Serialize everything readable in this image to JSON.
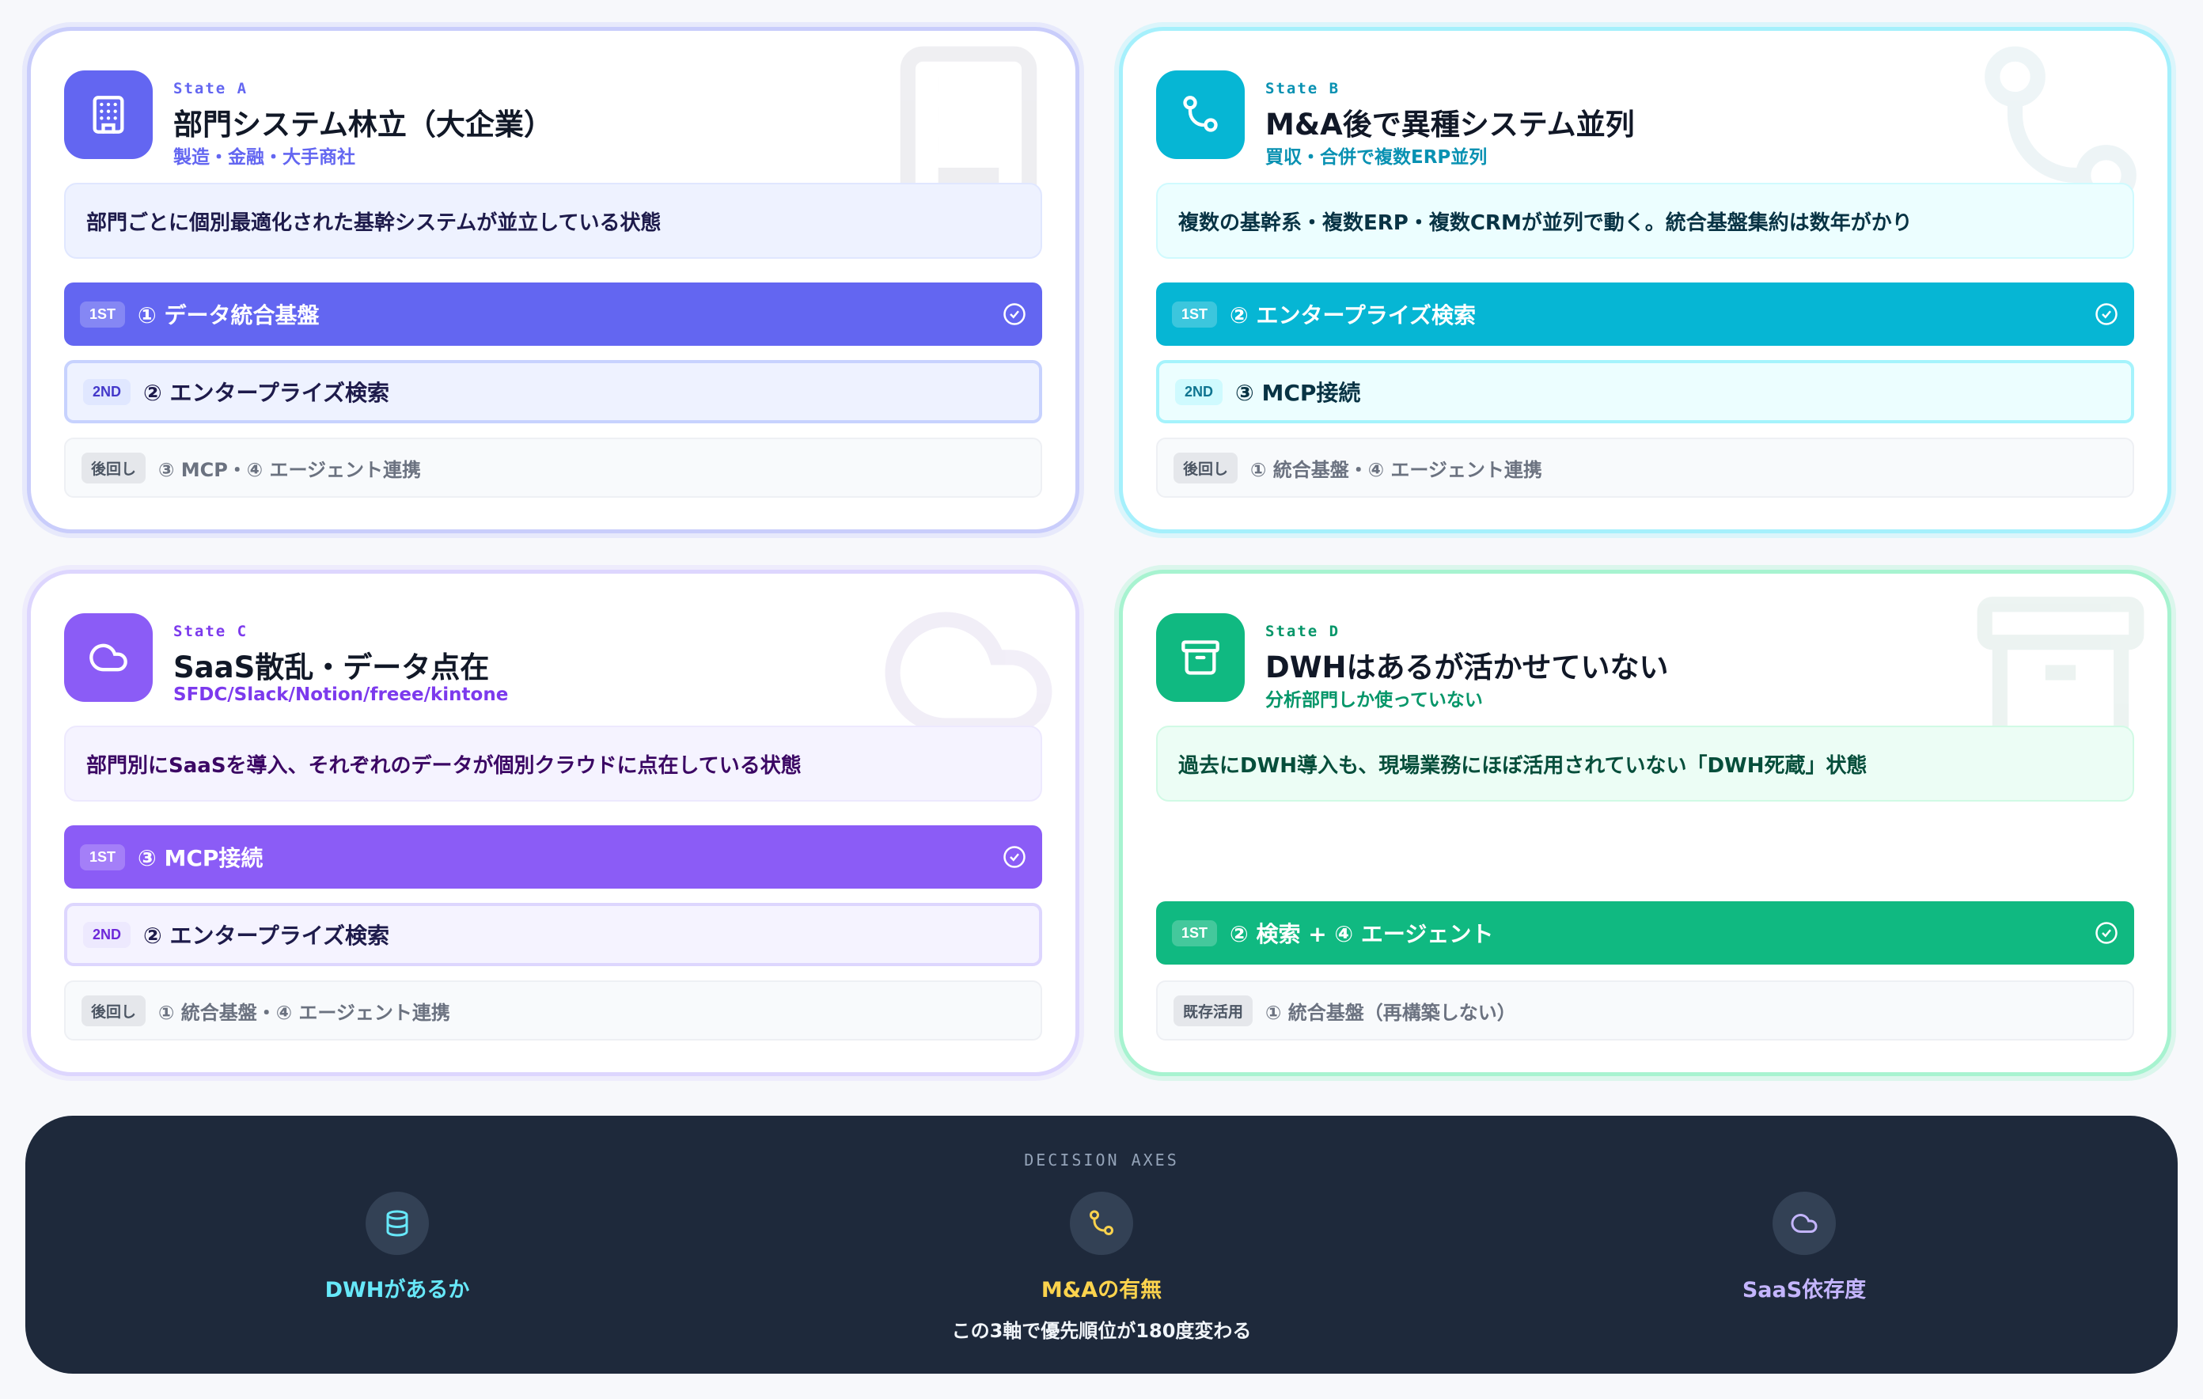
{
  "colors": {
    "state_a": "#6366f1",
    "state_b": "#06b6d4",
    "state_c": "#8b5cf6",
    "state_d": "#10b981",
    "axes_bg": "#1e293b"
  },
  "cards": [
    {
      "id": "a",
      "icon": "building-icon",
      "state_label": "State A",
      "title": "部門システム林立（大企業）",
      "subtitle": "製造・金融・大手商社",
      "description": "部門ごとに個別最適化された基幹システムが並立している状態",
      "first": {
        "badge": "1ST",
        "label": "① データ統合基盤"
      },
      "second": {
        "badge": "2ND",
        "label": "② エンタープライズ検索"
      },
      "later": {
        "badge": "後回し",
        "label": "③ MCP・④ エージェント連携"
      }
    },
    {
      "id": "b",
      "icon": "git-merge-icon",
      "state_label": "State B",
      "title": "M&A後で異種システム並列",
      "subtitle": "買収・合併で複数ERP並列",
      "description": "複数の基幹系・複数ERP・複数CRMが並列で動く。統合基盤集約は数年がかり",
      "first": {
        "badge": "1ST",
        "label": "② エンタープライズ検索"
      },
      "second": {
        "badge": "2ND",
        "label": "③ MCP接続"
      },
      "later": {
        "badge": "後回し",
        "label": "① 統合基盤・④ エージェント連携"
      }
    },
    {
      "id": "c",
      "icon": "cloud-icon",
      "state_label": "State C",
      "title": "SaaS散乱・データ点在",
      "subtitle": "SFDC/Slack/Notion/freee/kintone",
      "description": "部門別にSaaSを導入、それぞれのデータが個別クラウドに点在している状態",
      "first": {
        "badge": "1ST",
        "label": "③ MCP接続"
      },
      "second": {
        "badge": "2ND",
        "label": "② エンタープライズ検索"
      },
      "later": {
        "badge": "後回し",
        "label": "① 統合基盤・④ エージェント連携"
      }
    },
    {
      "id": "d",
      "icon": "archive-icon",
      "state_label": "State D",
      "title": "DWHはあるが活かせていない",
      "subtitle": "分析部門しか使っていない",
      "description": "過去にDWH導入も、現場業務にほぼ活用されていない「DWH死蔵」状態",
      "first": {
        "badge": "1ST",
        "label": "② 検索 + ④ エージェント"
      },
      "later": {
        "badge": "既存活用",
        "label": "① 統合基盤（再構築しない）"
      }
    }
  ],
  "decision_axes": {
    "title": "DECISION AXES",
    "axes": [
      {
        "icon": "database-icon",
        "label": "DWHがあるか",
        "color": "#67e8f9"
      },
      {
        "icon": "git-merge-icon",
        "label": "M&Aの有無",
        "color": "#fcd34d"
      },
      {
        "icon": "cloud-icon",
        "label": "SaaS依存度",
        "color": "#c4b5fd"
      }
    ],
    "footer": "この3軸で優先順位が180度変わる"
  }
}
